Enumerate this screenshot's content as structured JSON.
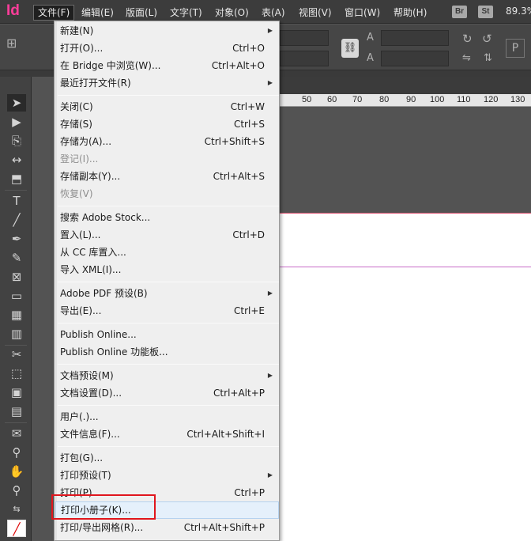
{
  "app": {
    "logo": "Id",
    "zoom": "89.3"
  },
  "menubar": {
    "items": [
      "文件(F)",
      "编辑(E)",
      "版面(L)",
      "文字(T)",
      "对象(O)",
      "表(A)",
      "视图(V)",
      "窗口(W)",
      "帮助(H)"
    ],
    "badges": [
      "Br",
      "St"
    ]
  },
  "controlbar": {
    "label_p": "P"
  },
  "ruler": {
    "labels": [
      "50",
      "60",
      "70",
      "80",
      "90",
      "100",
      "110",
      "120",
      "130"
    ]
  },
  "file_menu": {
    "groups": [
      {
        "items": [
          {
            "label": "新建(N)",
            "submenu": true
          },
          {
            "label": "打开(O)...",
            "shortcut": "Ctrl+O"
          },
          {
            "label": "在 Bridge 中浏览(W)...",
            "shortcut": "Ctrl+Alt+O"
          },
          {
            "label": "最近打开文件(R)",
            "submenu": true
          }
        ]
      },
      {
        "items": [
          {
            "label": "关闭(C)",
            "shortcut": "Ctrl+W"
          },
          {
            "label": "存储(S)",
            "shortcut": "Ctrl+S"
          },
          {
            "label": "存储为(A)...",
            "shortcut": "Ctrl+Shift+S"
          },
          {
            "label": "登记(I)...",
            "disabled": true
          },
          {
            "label": "存储副本(Y)...",
            "shortcut": "Ctrl+Alt+S"
          },
          {
            "label": "恢复(V)",
            "disabled": true
          }
        ]
      },
      {
        "items": [
          {
            "label": "搜索 Adobe Stock..."
          },
          {
            "label": "置入(L)...",
            "shortcut": "Ctrl+D"
          },
          {
            "label": "从 CC 库置入..."
          },
          {
            "label": "导入 XML(I)..."
          }
        ]
      },
      {
        "items": [
          {
            "label": "Adobe PDF 预设(B)",
            "submenu": true
          },
          {
            "label": "导出(E)...",
            "shortcut": "Ctrl+E"
          }
        ]
      },
      {
        "items": [
          {
            "label": "Publish Online..."
          },
          {
            "label": "Publish Online 功能板..."
          }
        ]
      },
      {
        "items": [
          {
            "label": "文档预设(M)",
            "submenu": true
          },
          {
            "label": "文档设置(D)...",
            "shortcut": "Ctrl+Alt+P"
          }
        ]
      },
      {
        "items": [
          {
            "label": "用户(.)..."
          },
          {
            "label": "文件信息(F)...",
            "shortcut": "Ctrl+Alt+Shift+I"
          }
        ]
      },
      {
        "items": [
          {
            "label": "打包(G)..."
          },
          {
            "label": "打印预设(T)",
            "submenu": true
          },
          {
            "label": "打印(P)...",
            "shortcut": "Ctrl+P"
          },
          {
            "label": "打印小册子(K)...",
            "highlighted": true
          },
          {
            "label": "打印/导出网格(R)...",
            "shortcut": "Ctrl+Alt+Shift+P"
          }
        ]
      }
    ]
  },
  "colors": {
    "accent": "#ff3d9a",
    "callout": "#e0161e",
    "highlight": "#e5f0fb"
  }
}
